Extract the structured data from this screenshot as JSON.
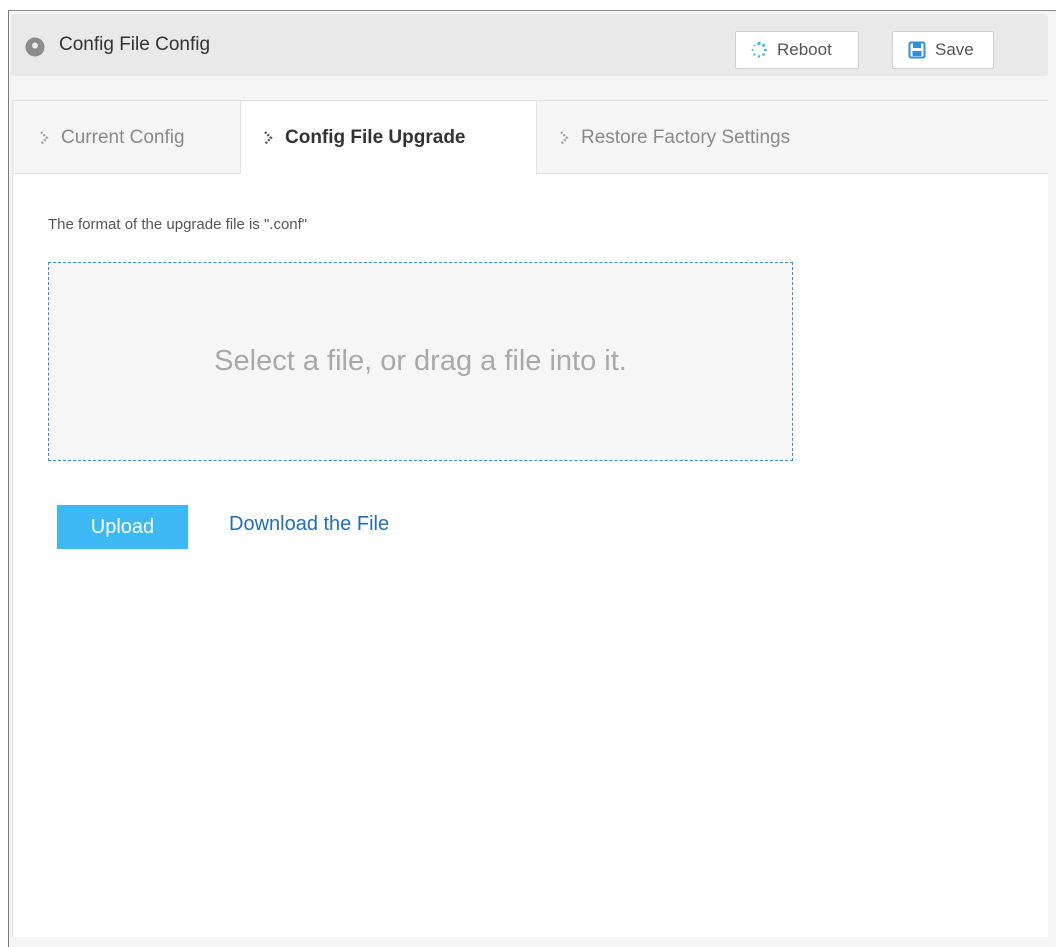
{
  "header": {
    "title": "Config File Config",
    "title_icon": "location-pin-icon",
    "reboot_label": "Reboot",
    "reboot_icon": "spinner-icon",
    "save_label": "Save",
    "save_icon": "floppy-disk-icon"
  },
  "tabs": [
    {
      "label": "Current Config",
      "active": false
    },
    {
      "label": "Config File Upgrade",
      "active": true
    },
    {
      "label": "Restore Factory Settings",
      "active": false
    }
  ],
  "main": {
    "format_hint": "The format of the upgrade file is \".conf\"",
    "dropzone_text": "Select a file, or drag a file into it.",
    "upload_label": "Upload",
    "download_label": "Download the File"
  },
  "colors": {
    "accent_blue": "#3cb8f4",
    "link_blue": "#1f6fb8",
    "dropzone_border": "#3c8dd8"
  }
}
